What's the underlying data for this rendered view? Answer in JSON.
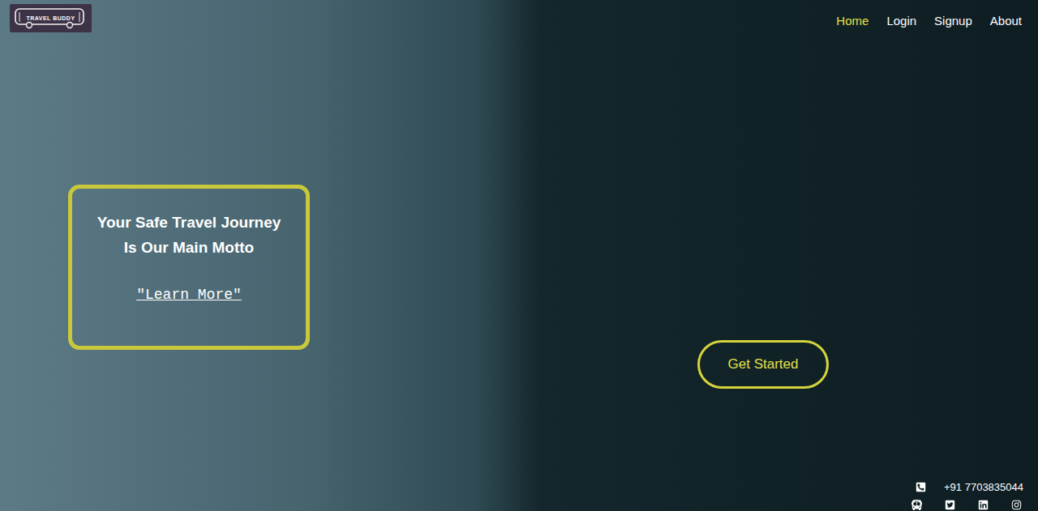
{
  "logo": {
    "text": "TRAVEL BUDDY"
  },
  "nav": [
    {
      "label": "Home",
      "selected": true
    },
    {
      "label": "Login",
      "selected": false
    },
    {
      "label": "Signup",
      "selected": false
    },
    {
      "label": "About",
      "selected": false
    }
  ],
  "hero": {
    "title_lines": [
      "Your Safe Travel Journey",
      "Is Our Main Motto"
    ],
    "link": "\"Learn More\"",
    "button": "Get Started"
  },
  "contact": {
    "phone": "+91 7703835044"
  }
}
